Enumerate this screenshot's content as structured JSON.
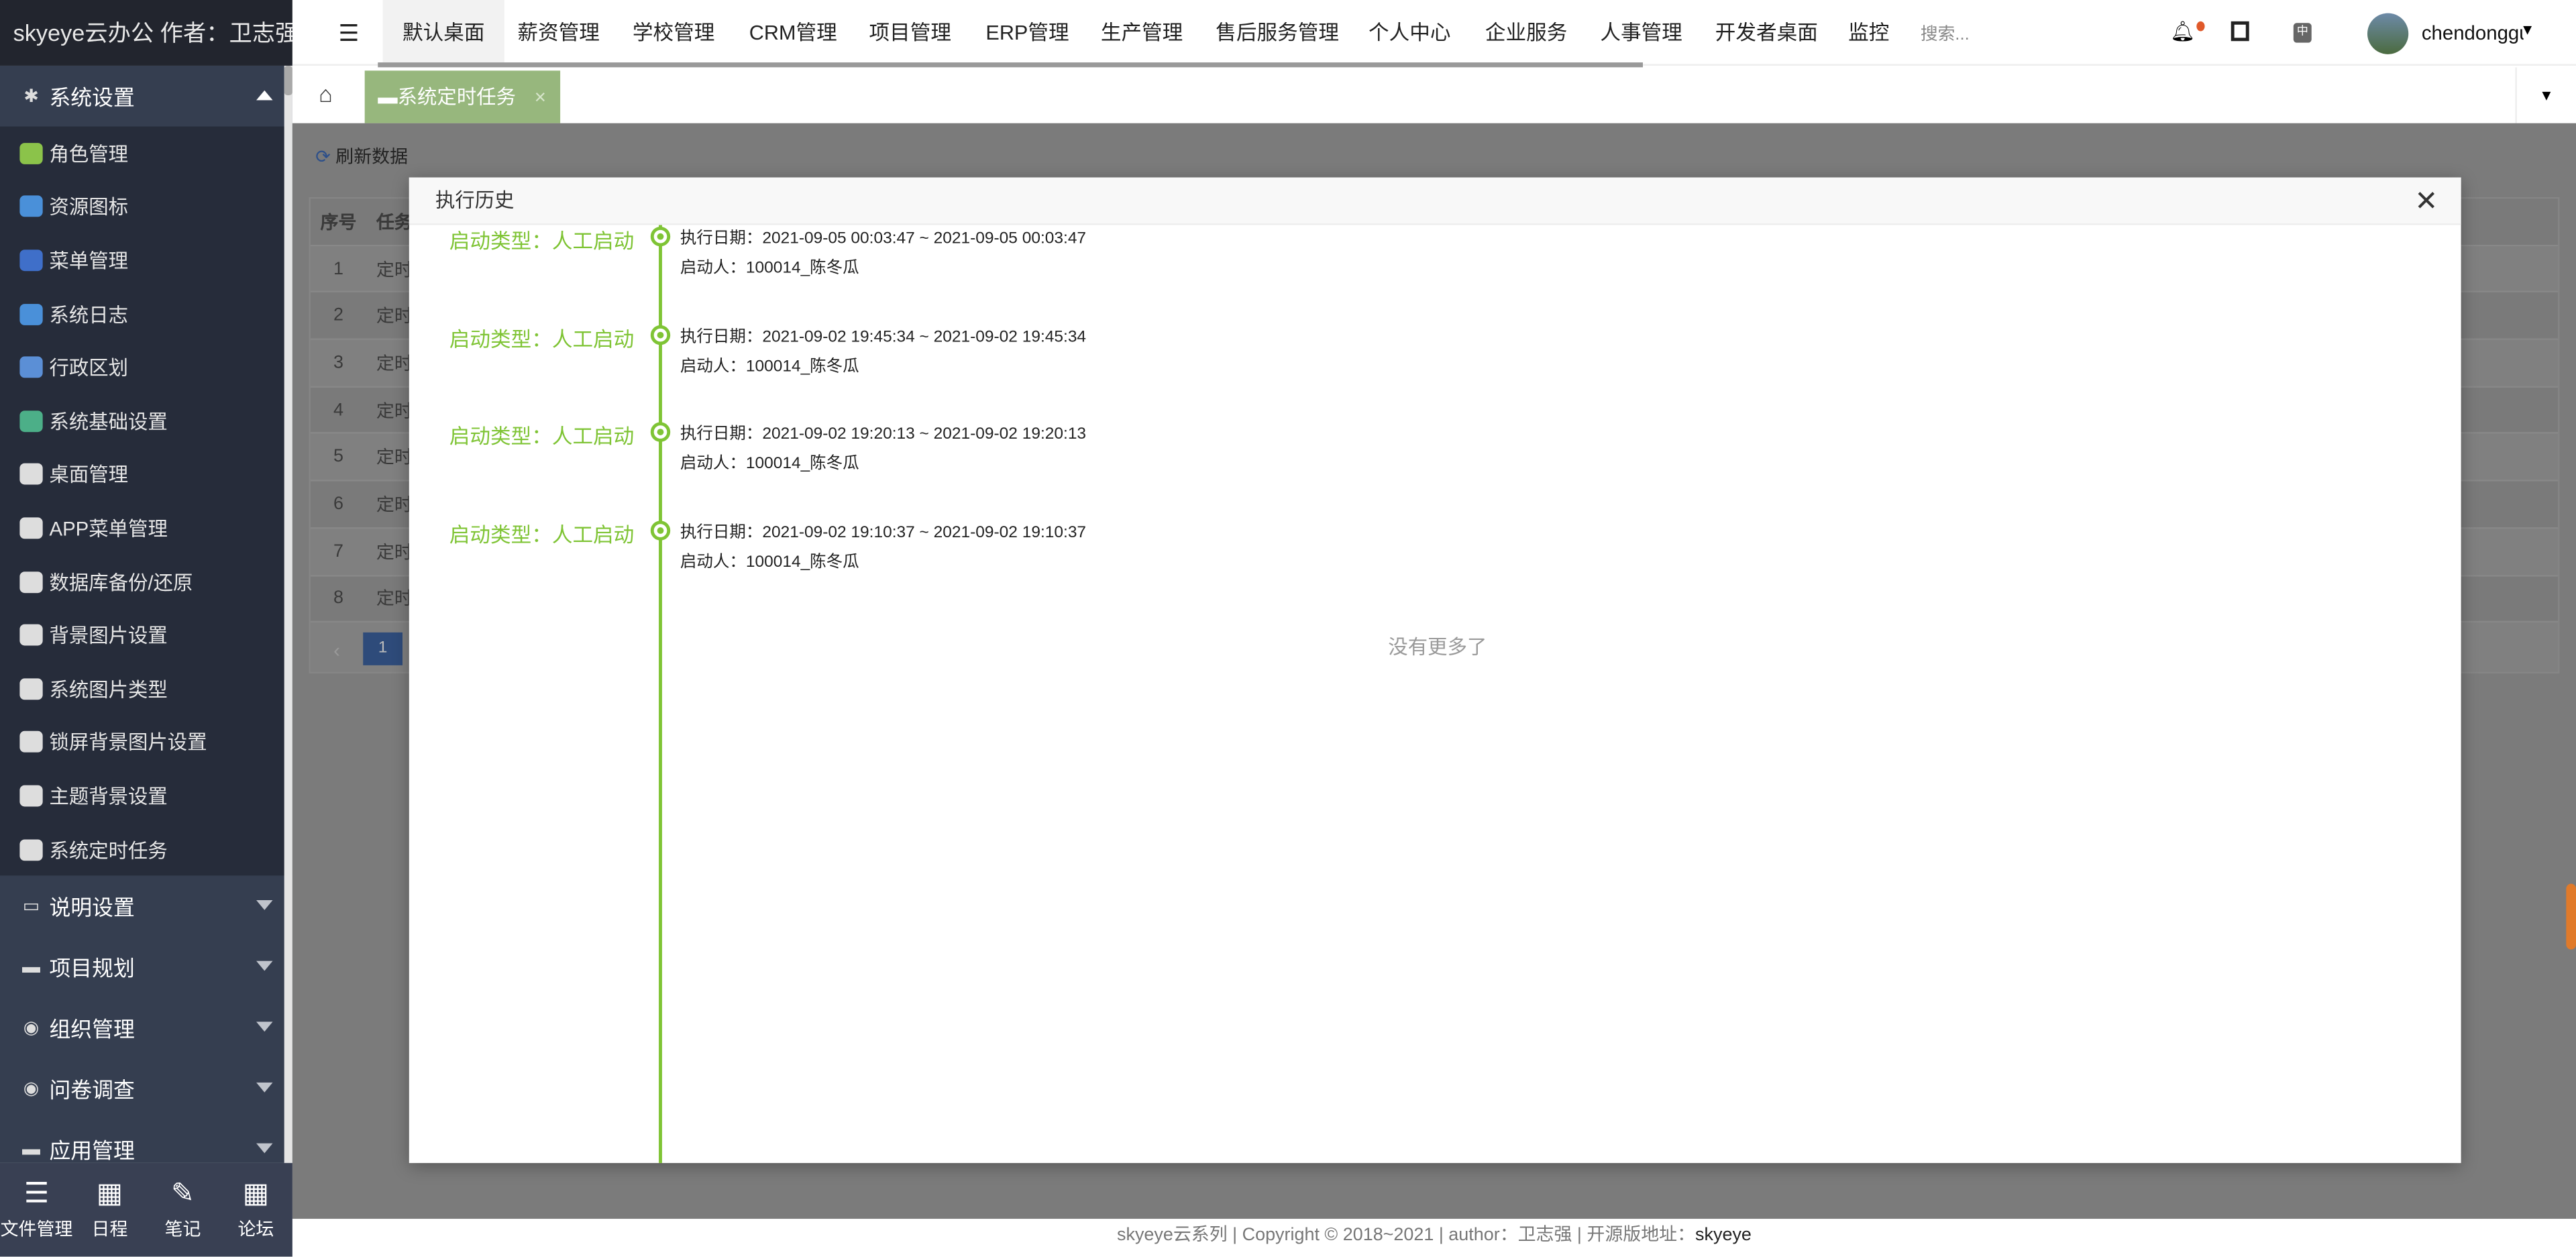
{
  "app": {
    "title": "skyeye云办公 作者：卫志强"
  },
  "sidebar": {
    "group_open": {
      "label": "系统设置",
      "icon": "gear-icon"
    },
    "items": [
      {
        "label": "角色管理",
        "icon": "role-icon",
        "color": "#8bc34a"
      },
      {
        "label": "资源图标",
        "icon": "resource-icon",
        "color": "#4a90d9"
      },
      {
        "label": "菜单管理",
        "icon": "menu-icon",
        "color": "#3f6fc9"
      },
      {
        "label": "系统日志",
        "icon": "log-icon",
        "color": "#4a90d9"
      },
      {
        "label": "行政区划",
        "icon": "region-icon",
        "color": "#5b8fd6"
      },
      {
        "label": "系统基础设置",
        "icon": "settings-icon",
        "color": "#4caf88"
      },
      {
        "label": "桌面管理",
        "icon": "desktop-icon",
        "color": "#ddd"
      },
      {
        "label": "APP菜单管理",
        "icon": "android-icon",
        "color": "#ddd"
      },
      {
        "label": "数据库备份/还原",
        "icon": "database-icon",
        "color": "#ddd"
      },
      {
        "label": "背景图片设置",
        "icon": "image-icon",
        "color": "#ddd"
      },
      {
        "label": "系统图片类型",
        "icon": "hourglass-icon",
        "color": "#ddd"
      },
      {
        "label": "锁屏背景图片设置",
        "icon": "lock-image-icon",
        "color": "#ddd"
      },
      {
        "label": "主题背景设置",
        "icon": "theme-icon",
        "color": "#ddd"
      },
      {
        "label": "系统定时任务",
        "icon": "archive-icon",
        "color": "#ddd"
      }
    ],
    "groups": [
      {
        "label": "说明设置",
        "icon": "monitor-icon"
      },
      {
        "label": "项目规划",
        "icon": "archive-icon"
      },
      {
        "label": "组织管理",
        "icon": "org-icon"
      },
      {
        "label": "问卷调查",
        "icon": "survey-icon"
      },
      {
        "label": "应用管理",
        "icon": "archive-icon"
      }
    ],
    "bottom": [
      {
        "label": "文件管理",
        "icon": "list-icon"
      },
      {
        "label": "日程",
        "icon": "calendar-icon"
      },
      {
        "label": "笔记",
        "icon": "edit-icon"
      },
      {
        "label": "论坛",
        "icon": "calendar-icon"
      }
    ]
  },
  "topnav": {
    "menu": [
      "默认桌面",
      "薪资管理",
      "学校管理",
      "CRM管理",
      "项目管理",
      "ERP管理",
      "生产管理",
      "售后服务管理",
      "个人中心",
      "企业服务",
      "人事管理",
      "开发者桌面",
      "监控"
    ],
    "active": "默认桌面",
    "search_placeholder": "搜索...",
    "username": "chendonggua",
    "notification_color": "#e0592a"
  },
  "tabs": [
    {
      "label": "系统定时任务",
      "active_color": "#97b77d"
    }
  ],
  "toolbar": {
    "refresh": "刷新数据"
  },
  "table": {
    "headers": [
      "序号",
      "任务"
    ],
    "rows": [
      [
        "1",
        "定时"
      ],
      [
        "2",
        "定时"
      ],
      [
        "3",
        "定时"
      ],
      [
        "4",
        "定时"
      ],
      [
        "5",
        "定时"
      ],
      [
        "6",
        "定时"
      ],
      [
        "7",
        "定时"
      ],
      [
        "8",
        "定时"
      ]
    ],
    "page": "1"
  },
  "modal": {
    "title": "执行历史",
    "entries": [
      {
        "type": "启动类型：人工启动",
        "date": "执行日期：2021-09-05 00:03:47 ~ 2021-09-05 00:03:47",
        "starter": "启动人：100014_陈冬瓜"
      },
      {
        "type": "启动类型：人工启动",
        "date": "执行日期：2021-09-02 19:45:34 ~ 2021-09-02 19:45:34",
        "starter": "启动人：100014_陈冬瓜"
      },
      {
        "type": "启动类型：人工启动",
        "date": "执行日期：2021-09-02 19:20:13 ~ 2021-09-02 19:20:13",
        "starter": "启动人：100014_陈冬瓜"
      },
      {
        "type": "启动类型：人工启动",
        "date": "执行日期：2021-09-02 19:10:37 ~ 2021-09-02 19:10:37",
        "starter": "启动人：100014_陈冬瓜"
      }
    ],
    "no_more": "没有更多了",
    "accent": "#7fc435"
  },
  "footer": {
    "text": "skyeye云系列 | Copyright © 2018~2021 | author：卫志强 | 开源版地址：",
    "link": "skyeye"
  }
}
